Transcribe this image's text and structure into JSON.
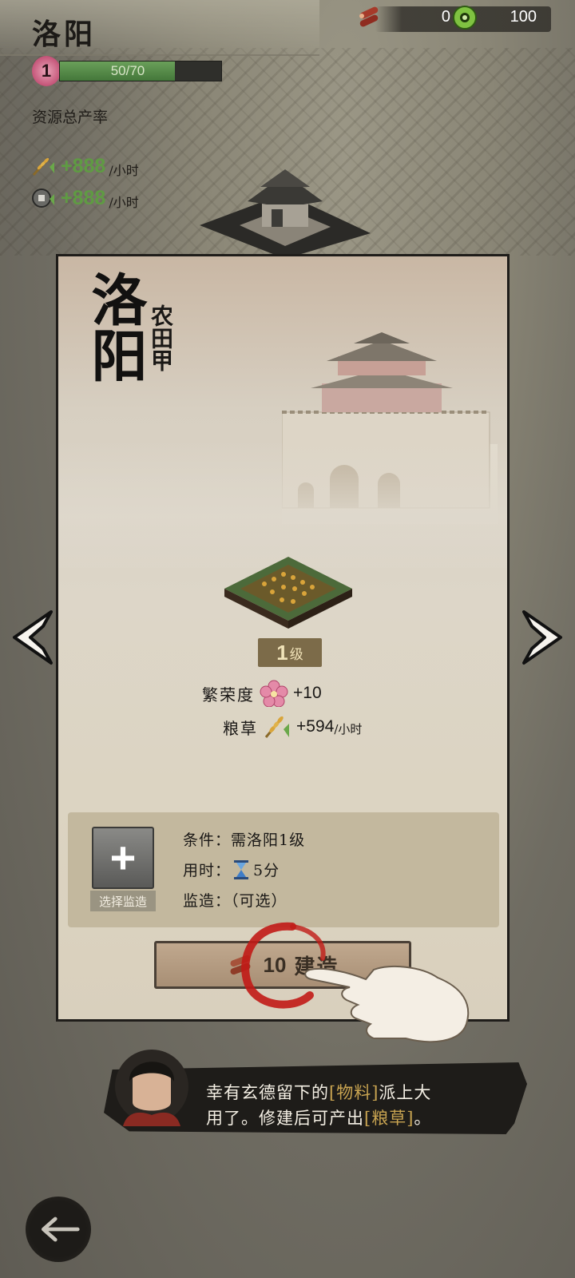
{
  "header": {
    "city_name": "洛阳",
    "level": "1",
    "exp_text": "50/70",
    "exp_progress": 0.714,
    "rate_title": "资源总产率",
    "rates": [
      {
        "icon": "grain-icon",
        "value": "+888",
        "unit": "/小时"
      },
      {
        "icon": "coin-icon",
        "value": "+888",
        "unit": "/小时"
      }
    ]
  },
  "resources": {
    "material_icon": "wood-logs-icon",
    "material_value": "0",
    "gem_icon": "jade-coin-icon",
    "gem_value": "100"
  },
  "panel": {
    "city_name": "洛阳",
    "plot_name": "农田甲",
    "level_num": "1",
    "level_unit": "级",
    "stats": [
      {
        "label": "繁荣度",
        "icon": "prosperity-flower-icon",
        "value": "+10",
        "unit": ""
      },
      {
        "label": "粮草",
        "icon": "grain-icon",
        "value": "+594",
        "unit": "/小时"
      }
    ],
    "supervisor_label": "选择监造",
    "conditions": {
      "requirement": "条件：需洛阳1级",
      "time_label": "用时：",
      "time_value": "5分",
      "supervisor": "监造：（可选）"
    },
    "build_button": {
      "cost": "10",
      "label": "建造"
    }
  },
  "dialog": {
    "line1_a": "幸有玄德留下的",
    "line1_hl": "[物料]",
    "line1_b": "派上大",
    "line2_a": "用了。修建后可产出",
    "line2_hl": "[粮草]",
    "line2_b": "。"
  },
  "colors": {
    "rate_green": "#5f9b43",
    "highlight_gold": "#c9a451",
    "level_tag": "#7c6b49"
  }
}
